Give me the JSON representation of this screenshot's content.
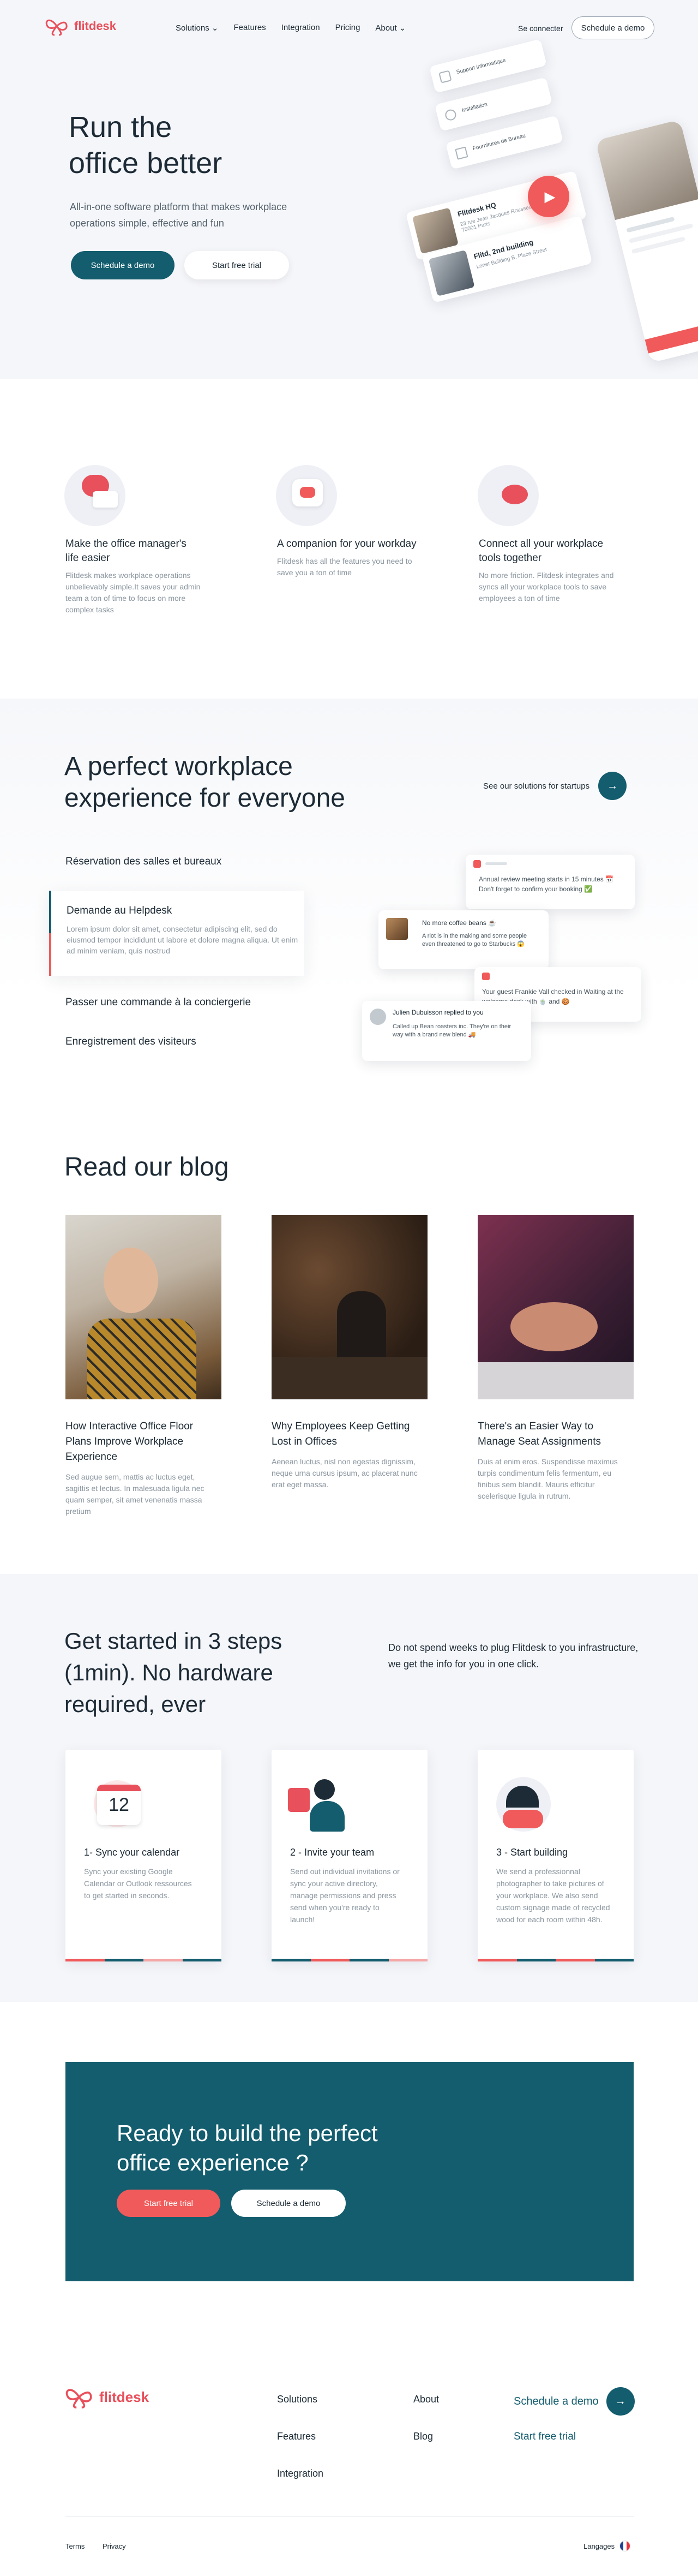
{
  "brand": {
    "name": "flitdesk",
    "accent": "#e8505b",
    "teal": "#135d6e"
  },
  "nav": {
    "links": [
      "Solutions",
      "Features",
      "Integration",
      "Pricing",
      "About"
    ],
    "login": "Se connecter",
    "demo": "Schedule a demo"
  },
  "hero": {
    "title_line1": "Run the",
    "title_line2": "office better",
    "subtitle": "All-in-one software platform that makes workplace operations simple, effective and fun",
    "cta_primary": "Schedule a demo",
    "cta_secondary": "Start free trial",
    "mock": {
      "menu": [
        "Support informatique",
        "Installation",
        "Fournitures de Bureau"
      ],
      "room1": {
        "name": "Flitdesk HQ",
        "line": "23 rue Jean Jacques Rousseau, 75001 Paris"
      },
      "room2": {
        "name": "Flitd, 2nd building",
        "line": "Lenet Building B, Place Street"
      }
    }
  },
  "features": [
    {
      "title": "Make the office manager's life easier",
      "text": "Flitdesk makes workplace operations unbelievably simple.It saves your admin team a ton of time to focus on more complex tasks"
    },
    {
      "title": "A companion for your workday",
      "text": "Flitdesk has all the features you need to save you a ton of time"
    },
    {
      "title": "Connect all your workplace tools together",
      "text": "No more friction. Flitdesk integrates and syncs all your workplace tools to save employees a ton of time"
    }
  ],
  "workplace": {
    "title_line1": "A perfect workplace",
    "title_line2": "experience for everyone",
    "startups_link": "See our solutions for startups",
    "items": [
      "Réservation des salles et bureaux",
      "Demande au Helpdesk",
      "Passer une commande à la conciergerie",
      "Enregistrement des visiteurs"
    ],
    "active_text": "Lorem ipsum dolor sit amet, consectetur adipiscing elit, sed do eiusmod tempor incididunt ut labore et dolore magna aliqua. Ut enim ad minim veniam, quis nostrud",
    "notif1": "Annual review meeting starts in 15 minutes 📅 Don't forget to confirm your booking ✅",
    "notif2_title": "No more coffee beans ☕",
    "notif2_text": "A riot is in the making and some people even threatened to go to Starbucks 😱",
    "notif3": "Your guest Frankie Vall checked in Waiting at the welcome desk with 🍵 and 🍪",
    "notif4_title": "Julien Dubuisson replied to you",
    "notif4_text": "Called up Bean roasters inc. They're on their way with a brand new blend 🚚"
  },
  "blog": {
    "title": "Read our blog",
    "posts": [
      {
        "title": "How Interactive Office Floor Plans Improve Workplace Experience",
        "text": "Sed augue sem, mattis ac luctus eget, sagittis et lectus. In malesuada ligula nec quam semper, sit amet venenatis massa pretium"
      },
      {
        "title": "Why Employees Keep Getting Lost in Offices",
        "text": "Aenean luctus, nisl non egestas dignissim, neque urna cursus ipsum, ac placerat nunc erat eget massa."
      },
      {
        "title": "There's an Easier Way to Manage Seat Assignments",
        "text": "Duis at enim eros. Suspendisse maximus turpis condimentum felis fermentum, eu finibus sem blandit. Mauris efficitur scelerisque ligula in rutrum."
      }
    ]
  },
  "steps": {
    "title": "Get started in 3 steps (1min). No hardware required, ever",
    "aside": "Do not spend weeks to plug Flitdesk to you infrastructure, we get the info for you in one click.",
    "calendar_day": "12",
    "items": [
      {
        "title": "1- Sync your calendar",
        "text": "Sync your existing Google Calendar or Outlook ressources to get started in seconds."
      },
      {
        "title": "2 - Invite your team",
        "text": "Send out individual invitations or sync your active directory, manage permissions and press send when you're ready to launch!"
      },
      {
        "title": "3 - Start building",
        "text": "We send a professionnal photographer to take pictures of your workplace. We also send custom signage made of recycled wood for each room within 48h."
      }
    ]
  },
  "cta": {
    "title": "Ready to build the perfect office experience ?",
    "primary": "Start free trial",
    "secondary": "Schedule a demo"
  },
  "footer": {
    "col1": [
      "Solutions",
      "Features",
      "Integration"
    ],
    "col2": [
      "About",
      "Blog"
    ],
    "demo": "Schedule a demo",
    "trial": "Start free trial",
    "terms": "Terms",
    "privacy": "Privacy",
    "language": "Langages"
  }
}
